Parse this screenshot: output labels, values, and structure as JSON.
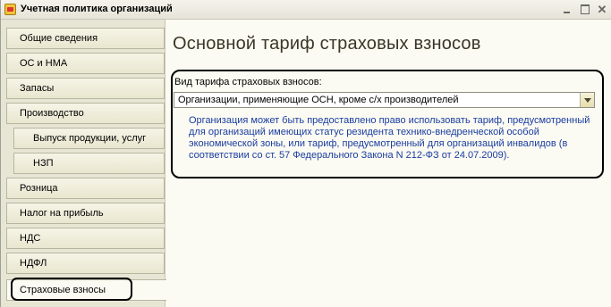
{
  "window": {
    "title": "Учетная политика организаций",
    "controls": [
      "minimize",
      "maximize",
      "close"
    ]
  },
  "tabs": [
    {
      "label": "Общие сведения",
      "sub": false
    },
    {
      "label": "ОС и НМА",
      "sub": false
    },
    {
      "label": "Запасы",
      "sub": false
    },
    {
      "label": "Производство",
      "sub": false
    },
    {
      "label": "Выпуск продукции, услуг",
      "sub": true
    },
    {
      "label": "НЗП",
      "sub": true
    },
    {
      "label": "Розница",
      "sub": false
    },
    {
      "label": "Налог на прибыль",
      "sub": false
    },
    {
      "label": "НДС",
      "sub": false
    },
    {
      "label": "НДФЛ",
      "sub": false
    },
    {
      "label": "Страховые взносы",
      "sub": false,
      "selected": true
    }
  ],
  "main": {
    "title": "Основной тариф страховых взносов",
    "tariff_label": "Вид тарифа страховых взносов:",
    "tariff_value": "Организации, применяющие ОСН, кроме с/х производителей",
    "info": "Организация может быть предоставлено право использовать тариф, предусмотренный для организаций имеющих статус резидента технико-внедренческой особой экономической зоны, или тариф, предусмотренный для организаций инвалидов (в соответствии со ст. 57 Федерального Закона  N 212-ФЗ от 24.07.2009)."
  },
  "colors": {
    "info_text": "#1a3ca0",
    "tab_background": "#e7e6d4",
    "panel_background": "#fbfbf3"
  }
}
